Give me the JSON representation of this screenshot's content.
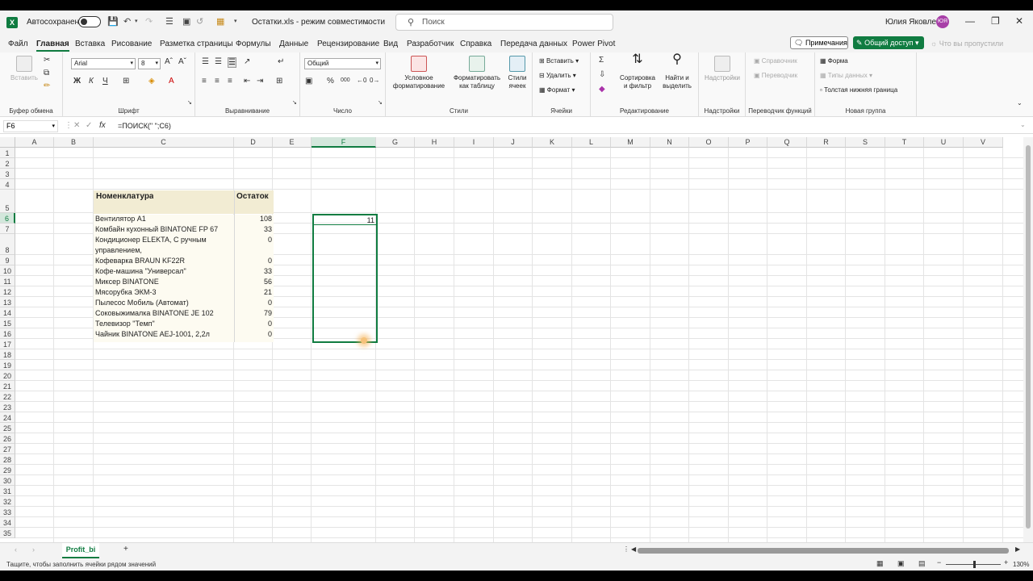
{
  "titlebar": {
    "autosave_label": "Автосохранение",
    "doc_title": "Остатки.xls  -  режим совместимости",
    "search_placeholder": "Поиск",
    "user_name": "Юлия Яковлева",
    "user_initials": "ЮЯ"
  },
  "menu": {
    "tabs": [
      "Файл",
      "Главная",
      "Вставка",
      "Рисование",
      "Разметка страницы",
      "Формулы",
      "Данные",
      "Рецензирование",
      "Вид",
      "Разработчик",
      "Справка",
      "Передача данных",
      "Power Pivot"
    ],
    "notes_label": "Примечания",
    "share_label": "Общий доступ",
    "tell_me": "Что вы пропустили"
  },
  "ribbon": {
    "clipboard": {
      "paste": "Вставить",
      "label": "Буфер обмена"
    },
    "font": {
      "name": "Arial",
      "size": "8",
      "bold": "Ж",
      "italic": "К",
      "underline": "Ч",
      "label": "Шрифт"
    },
    "alignment": {
      "label": "Выравнивание"
    },
    "number": {
      "format": "Общий",
      "label": "Число"
    },
    "styles": {
      "conditional": "Условное форматирование",
      "as_table": "Форматировать как таблицу",
      "cell_styles": "Стили ячеек",
      "label": "Стили"
    },
    "cells": {
      "insert": "Вставить",
      "delete": "Удалить",
      "format": "Формат",
      "label": "Ячейки"
    },
    "editing": {
      "sort": "Сортировка и фильтр",
      "find": "Найти и выделить",
      "label": "Редактирование"
    },
    "addins": {
      "button": "Надстройки",
      "label": "Надстройки"
    },
    "translator": {
      "reference": "Справочник",
      "translator": "Переводчик",
      "label": "Переводчик функций"
    },
    "new_group": {
      "form": "Форма",
      "data_types": "Типы данных",
      "thick_border": "Толстая нижняя граница",
      "label": "Новая группа"
    }
  },
  "formula_bar": {
    "name_box": "F6",
    "formula": "=ПОИСК(\"  \";C6)"
  },
  "sheet": {
    "columns": [
      "A",
      "B",
      "C",
      "D",
      "E",
      "F",
      "G",
      "H",
      "I",
      "J",
      "K",
      "L",
      "M",
      "N",
      "O",
      "P",
      "Q",
      "R",
      "S",
      "T",
      "U",
      "V"
    ],
    "rows": [
      "1",
      "2",
      "3",
      "4",
      "5",
      "6",
      "7",
      "8",
      "9",
      "10",
      "11",
      "12",
      "13",
      "14",
      "15",
      "16",
      "17",
      "18",
      "19",
      "20",
      "21",
      "22",
      "23",
      "24",
      "25",
      "26",
      "27",
      "28",
      "29",
      "30",
      "31",
      "32",
      "33",
      "34",
      "35"
    ],
    "header_name": "Номенклатура",
    "header_qty": "Остаток",
    "items": [
      {
        "name": "Вентилятор А1",
        "qty": "108"
      },
      {
        "name": "Комбайн кухонный BINATONE FP 67",
        "qty": "33"
      },
      {
        "name": "Кондиционер ELEKTA, С ручным управлением,",
        "qty": "0"
      },
      {
        "name": "Кофеварка BRAUN KF22R",
        "qty": "0"
      },
      {
        "name": "Кофе-машина \"Универсал\"",
        "qty": "33"
      },
      {
        "name": "Миксер BINATONE",
        "qty": "56"
      },
      {
        "name": "Мясорубка ЭКМ-3",
        "qty": "21"
      },
      {
        "name": "Пылесос Мобиль (Автомат)",
        "qty": "0"
      },
      {
        "name": "Соковыжималка  BINATONE JE 102",
        "qty": "79"
      },
      {
        "name": "Телевизор \"Темп\"",
        "qty": "0"
      },
      {
        "name": "Чайник BINATONE  AEJ-1001,  2,2л",
        "qty": "0"
      }
    ],
    "f6_value": "11"
  },
  "bottom": {
    "sheet_tab": "Profit_bi",
    "status": "Тащите, чтобы заполнить ячейки рядом значений",
    "zoom": "130%"
  }
}
